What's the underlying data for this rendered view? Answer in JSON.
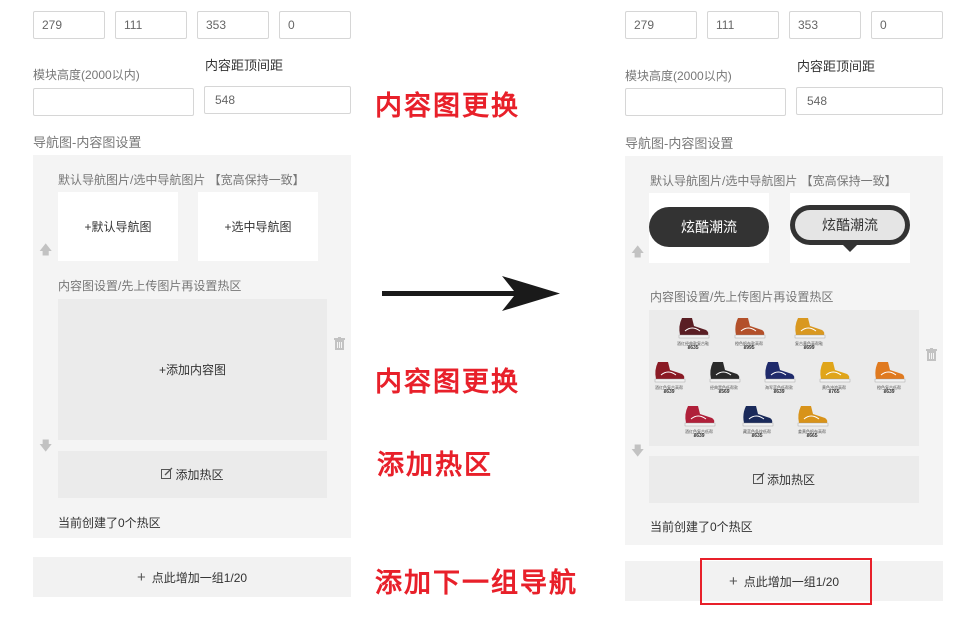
{
  "left_panel": {
    "numbers": [
      "279",
      "111",
      "353",
      "0"
    ],
    "height_label": "模块高度(2000以内)",
    "height_value": "",
    "top_spacing_label": "内容距顶间距",
    "top_spacing_value": "548",
    "section_title": "导航图-内容图设置",
    "nav_hint": "默认导航图片/选中导航图片 【宽高保持一致】",
    "default_nav_button": "+默认导航图",
    "selected_nav_button": "+选中导航图",
    "content_hint": "内容图设置/先上传图片再设置热区",
    "add_content_button": "+添加内容图",
    "add_hotspot_button": "添加热区",
    "hotspot_count": "当前创建了0个热区",
    "add_group_button": "点此增加一组1/20"
  },
  "right_panel": {
    "numbers": [
      "279",
      "111",
      "353",
      "0"
    ],
    "height_label": "模块高度(2000以内)",
    "height_value": "",
    "top_spacing_label": "内容距顶间距",
    "top_spacing_value": "548",
    "section_title": "导航图-内容图设置",
    "nav_hint": "默认导航图片/选中导航图片 【宽高保持一致】",
    "default_nav_image_text": "炫酷潮流",
    "selected_nav_image_text": "炫酷潮流",
    "content_hint": "内容图设置/先上传图片再设置热区",
    "shoes": [
      {
        "name": "酒红经典款复古鞋",
        "price": "¥635",
        "color": "#5a1e24"
      },
      {
        "name": "橙色帆布款高帮",
        "price": "¥995",
        "color": "#b3502a"
      },
      {
        "name": "复古黄色高帮鞋",
        "price": "¥699",
        "color": "#d99820"
      },
      {
        "name": "酒红色复古高帮",
        "price": "¥639",
        "color": "#8a1a24"
      },
      {
        "name": "经典黑色低帮款",
        "price": "¥569",
        "color": "#2a2a2a"
      },
      {
        "name": "海军蓝色低帮款",
        "price": "¥639",
        "color": "#1f2a6b"
      },
      {
        "name": "黄色冲浪高帮",
        "price": "¥765",
        "color": "#e0a51a"
      },
      {
        "name": "橙色复古低帮",
        "price": "¥639",
        "color": "#e07a20"
      },
      {
        "name": "酒红色复古低帮",
        "price": "¥639",
        "color": "#b0203a"
      },
      {
        "name": "藏蓝色条纹低帮",
        "price": "¥635",
        "color": "#1a2a5a"
      },
      {
        "name": "姜黄色帆布高帮",
        "price": "¥665",
        "color": "#d8931a"
      }
    ],
    "add_hotspot_button": "添加热区",
    "hotspot_count": "当前创建了0个热区",
    "add_group_button": "点此增加一组1/20"
  },
  "annotations": {
    "content_replace_1": "内容图更换",
    "content_replace_2": "内容图更换",
    "add_hotspot": "添加热区",
    "add_next_group": "添加下一组导航"
  },
  "icons": {
    "up": "arrow-up-icon",
    "down": "arrow-down-icon",
    "trash": "trash-icon",
    "edit": "edit-icon"
  },
  "colors": {
    "annotation_red": "#e8202a",
    "panel_bg": "#f4f4f4",
    "nav_pill_dark": "#333333"
  }
}
